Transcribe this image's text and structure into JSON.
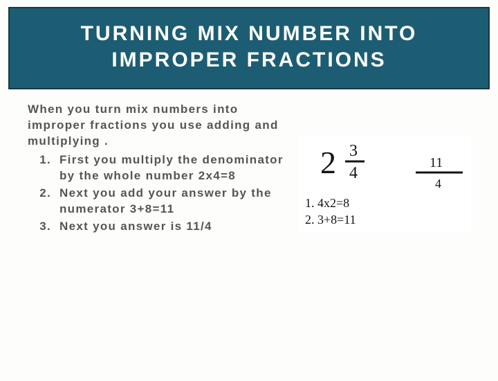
{
  "title": "TURNING MIX NUMBER INTO IMPROPER FRACTIONS",
  "intro": "When you turn mix numbers into improper fractions you use adding and multiplying .",
  "steps": [
    "First you multiply the denominator by the whole number 2x4=8",
    "Next you add your answer by the numerator 3+8=11",
    "Next you answer is 11/4"
  ],
  "sketch": {
    "whole": "2",
    "numerator": "3",
    "denominator": "4",
    "result_numerator": "11",
    "result_denominator": "4",
    "work1": "1. 4x2=8",
    "work2": "2. 3+8=11"
  }
}
